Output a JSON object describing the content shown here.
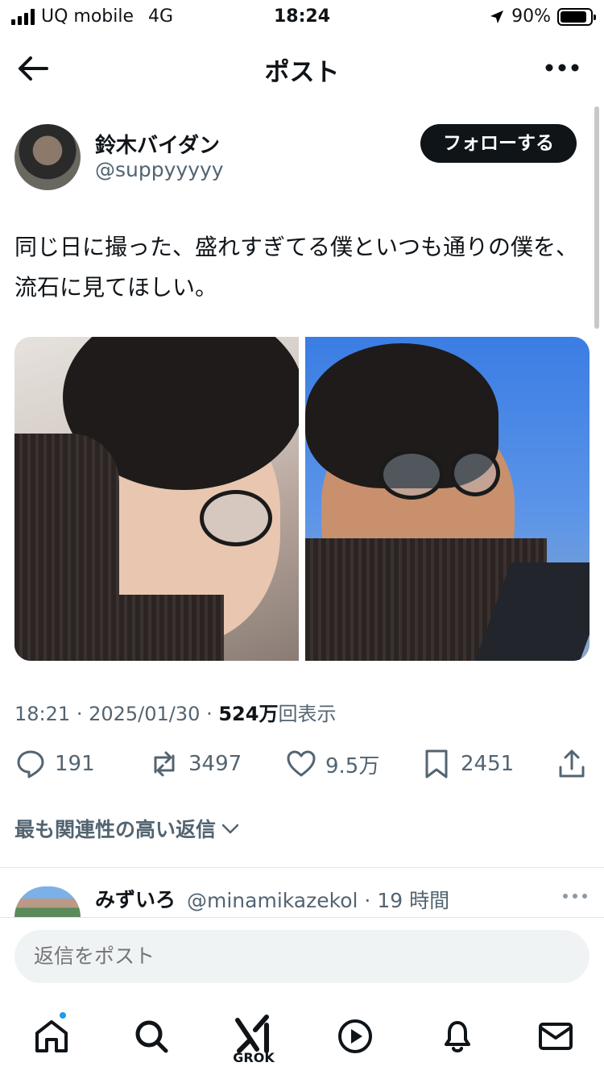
{
  "status_bar": {
    "carrier": "UQ mobile",
    "network": "4G",
    "time": "18:24",
    "battery_percent": "90%",
    "battery_level": 0.9,
    "icons": [
      "signal-bars-icon",
      "location-arrow-icon",
      "battery-icon"
    ]
  },
  "header": {
    "title": "ポスト",
    "back_icon": "arrow-left-icon",
    "more_icon": "more-horizontal-icon"
  },
  "author": {
    "name": "鈴木バイダン",
    "handle": "@suppyyyyy",
    "follow_label": "フォローする"
  },
  "post": {
    "text": "同じ日に撮った、盛れすぎてる僕といつも通りの僕を、流石に見てほしい。",
    "time": "18:21",
    "date": "2025/01/30",
    "views": "524万",
    "views_label": "回表示",
    "separator": "·"
  },
  "actions": {
    "replies": "191",
    "reposts": "3497",
    "likes": "9.5万",
    "bookmarks": "2451"
  },
  "relevance": {
    "label": "最も関連性の高い返信"
  },
  "reply_preview": {
    "name": "みずいろ",
    "handle": "@minamikazekol",
    "time": "19 時間",
    "separator": "·"
  },
  "reply_box": {
    "placeholder": "返信をポスト"
  },
  "tab_bar": {
    "grok_label": "GROK",
    "icons": [
      "home-icon",
      "search-icon",
      "grok-icon",
      "video-play-icon",
      "bell-icon",
      "mail-icon"
    ]
  },
  "colors": {
    "text": "#0f1419",
    "secondary": "#536471",
    "accent": "#1d9bf0",
    "button": "#0f1419"
  }
}
